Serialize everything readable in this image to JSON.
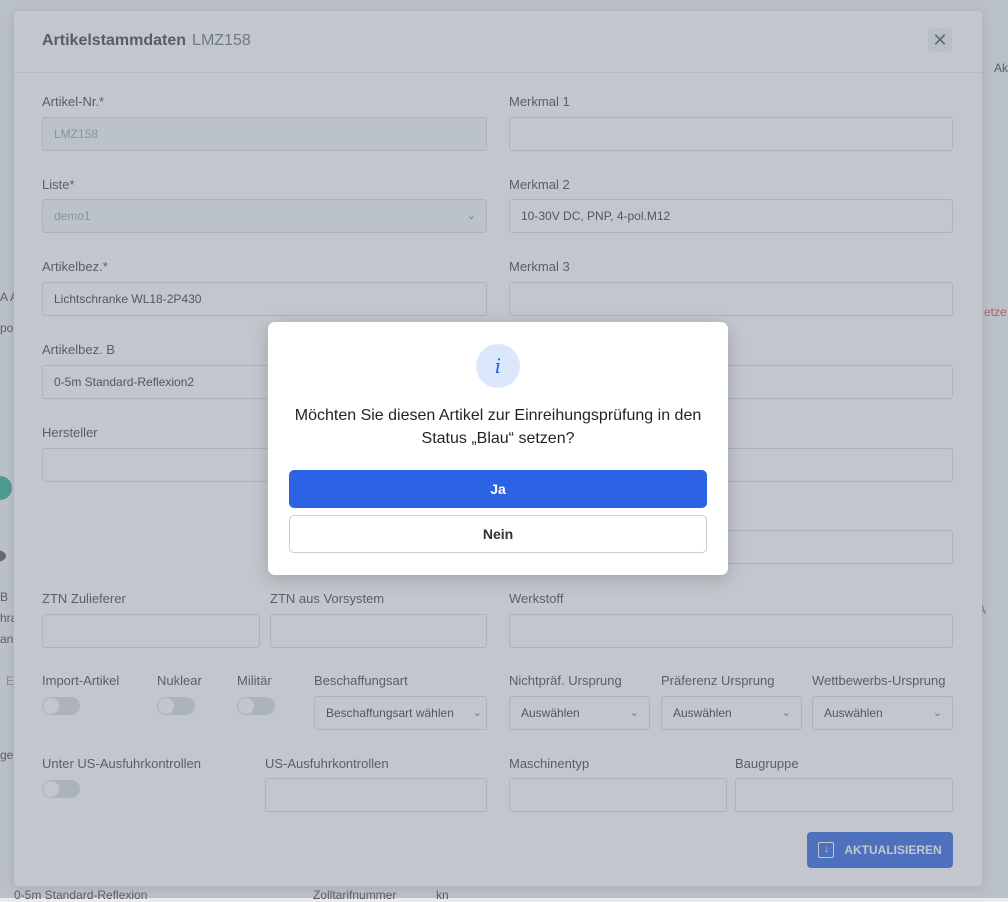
{
  "background": {
    "right_header": "Ak",
    "right_red": "etze",
    "right_red2": "A",
    "left_a": "A A",
    "left_por": "por",
    "left_b": "B",
    "left_hra": "hra",
    "left_an": "an",
    "left_e": "E",
    "left_ge": "ge",
    "bottom_left": "0-5m Standard-Reflexion",
    "bottom_mid": "Zolltarifnummer",
    "bottom_kn": "kn"
  },
  "modal": {
    "title": "Artikelstammdaten",
    "subtitle": "LMZ158",
    "close_icon": "close-icon"
  },
  "form": {
    "artikel_nr_label": "Artikel-Nr.*",
    "artikel_nr_value": "LMZ158",
    "liste_label": "Liste*",
    "liste_value": "demo1",
    "artikelbez_label": "Artikelbez.*",
    "artikelbez_value": "Lichtschranke WL18-2P430",
    "artikelbez_b_label": "Artikelbez. B",
    "artikelbez_b_value": "0-5m Standard-Reflexion2",
    "hersteller_label": "Hersteller",
    "merkmal1_label": "Merkmal 1",
    "merkmal2_label": "Merkmal 2",
    "merkmal2_value": "10-30V DC, PNP, 4-pol.M12",
    "merkmal3_label": "Merkmal 3",
    "ztn_zulieferer_label": "ZTN Zulieferer",
    "ztn_vorsystem_label": "ZTN aus Vorsystem",
    "werkstoff_label": "Werkstoff",
    "import_label": "Import-Artikel",
    "nuklear_label": "Nuklear",
    "militaer_label": "Militär",
    "beschaffungsart_label": "Beschaffungsart",
    "beschaffungsart_value": "Beschaffungsart wählen",
    "nichtpraef_label": "Nichtpräf. Ursprung",
    "nichtpraef_value": "Auswählen",
    "praeferenz_label": "Präferenz Ursprung",
    "praeferenz_value": "Auswählen",
    "wettbewerb_label": "Wettbewerbs-Ursprung",
    "wettbewerb_value": "Auswählen",
    "us_kontrollen_toggle_label": "Unter US-Ausfuhrkontrollen",
    "us_kontrollen_label": "US-Ausfuhrkontrollen",
    "maschinentyp_label": "Maschinentyp",
    "baugruppe_label": "Baugruppe",
    "update_button": "AKTUALISIEREN"
  },
  "dialog": {
    "icon": "info-icon",
    "message": "Möchten Sie diesen Artikel zur Einreihungsprüfung in den Status „Blau“ setzen?",
    "yes": "Ja",
    "no": "Nein"
  },
  "colors": {
    "primary": "#2c63e4",
    "overlay": "#78828f"
  }
}
